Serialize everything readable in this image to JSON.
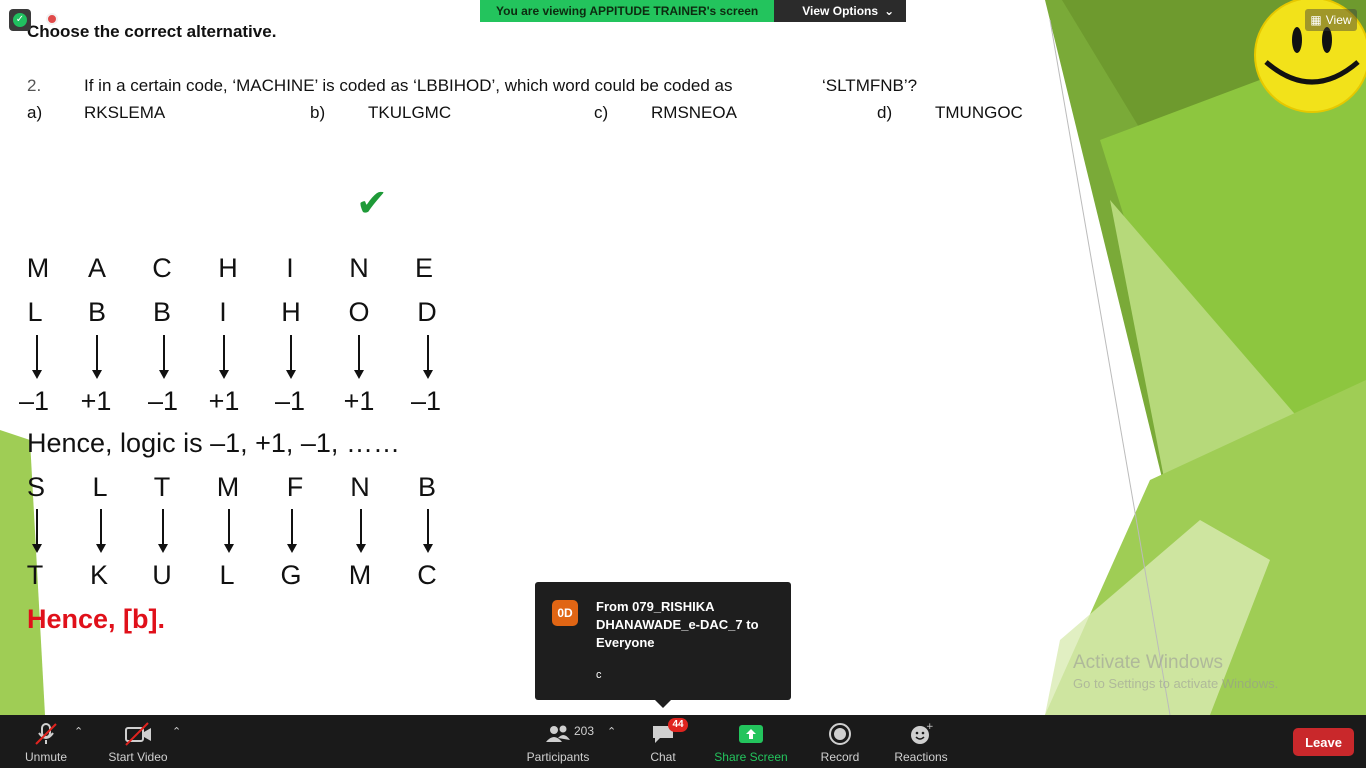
{
  "share_banner": {
    "text": "You are viewing APPITUDE TRAINER's screen",
    "view_options": "View Options"
  },
  "view_button": {
    "label": "View"
  },
  "slide": {
    "heading": "Choose the correct alternative.",
    "question_number": "2.",
    "question_text": "If in a certain code, ‘MACHINE’ is coded as ‘LBBIHOD’, which word could be coded as",
    "question_code": "‘SLTMFNB’?",
    "options": [
      {
        "label": "a)",
        "text": "RKSLEMA"
      },
      {
        "label": "b)",
        "text": "TKULGMC"
      },
      {
        "label": "c)",
        "text": "RMSNEOA"
      },
      {
        "label": "d)",
        "text": "TMUNGOC"
      }
    ],
    "checkmark": "✔",
    "row_machine": [
      "M",
      "A",
      "C",
      "H",
      "I",
      "N",
      "E"
    ],
    "row_coded": [
      "L",
      "B",
      "B",
      "I",
      "H",
      "O",
      "D"
    ],
    "row_diff": [
      "–1",
      "+1",
      "–1",
      "+1",
      "–1",
      "+1",
      "–1"
    ],
    "logic": "Hence, logic is –1, +1, –1, ……",
    "row_source": [
      "S",
      "L",
      "T",
      "M",
      "F",
      "N",
      "B"
    ],
    "row_result": [
      "T",
      "K",
      "U",
      "L",
      "G",
      "M",
      "C"
    ],
    "answer": "Hence, [b]."
  },
  "watermark": {
    "line1": "Activate Windows",
    "line2": "Go to Settings to activate Windows."
  },
  "chat_popup": {
    "avatar": "0D",
    "from": "From 079_RISHIKA DHANAWADE_e-DAC_7 to Everyone",
    "message": "c"
  },
  "toolbar": {
    "unmute": "Unmute",
    "start_video": "Start Video",
    "participants": "Participants",
    "participant_count": "203",
    "chat": "Chat",
    "chat_badge": "44",
    "share_screen": "Share Screen",
    "record": "Record",
    "reactions": "Reactions",
    "leave": "Leave"
  },
  "colors": {
    "green_banner": "#23c45d",
    "answer_red": "#e0101a",
    "leave_red": "#c9282b",
    "checkmark_green": "#1e9a38",
    "lime": "#8dc63f"
  }
}
